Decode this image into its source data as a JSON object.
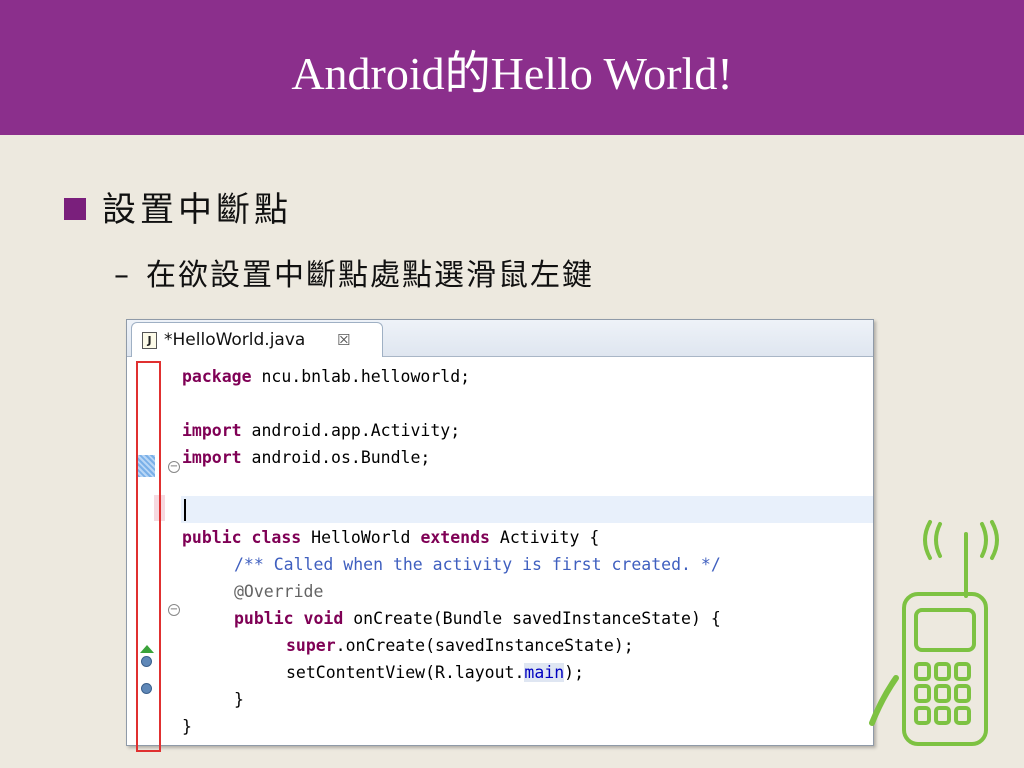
{
  "slide": {
    "title": "Android的Hello World!",
    "bullet": "設置中斷點",
    "dash": "–",
    "sub_bullet": "在欲設置中斷點處點選滑鼠左鍵"
  },
  "editor": {
    "tab": {
      "icon_letter": "J",
      "label": "*HelloWorld.java",
      "close": "☒"
    },
    "lines": {
      "l1_kw": "package",
      "l1_rest": " ncu.bnlab.helloworld;",
      "l3_kw": "import",
      "l3_rest": " android.app.Activity;",
      "l4_kw": "import",
      "l4_rest": " android.os.Bundle;",
      "l6_kw1": "public",
      "l6_kw2": "class",
      "l6_name": " HelloWorld ",
      "l6_kw3": "extends",
      "l6_rest": " Activity {",
      "l7_comment": "/** Called when the activity is first created. */",
      "l8_annotation": "@Override",
      "l9_kw1": "public",
      "l9_kw2": "void",
      "l9_rest": " onCreate(Bundle savedInstanceState) {",
      "l10_kw": "super",
      "l10_rest": ".onCreate(savedInstanceState);",
      "l11_pre": "setContentView(R.layout.",
      "l11_main": "main",
      "l11_post": ");",
      "l12": "}",
      "l13": "}"
    },
    "fold_symbol": "−"
  },
  "colors": {
    "title_bar": "#8b2f8c",
    "background": "#ede9df",
    "keyword": "#7f0055",
    "comment": "#3f5fbf",
    "highlight_box": "#e03030",
    "phone": "#7dc242"
  },
  "icons": {
    "java_file": "java-file-icon",
    "close_tab": "close-tab-icon",
    "phone": "mobile-phone-icon"
  }
}
